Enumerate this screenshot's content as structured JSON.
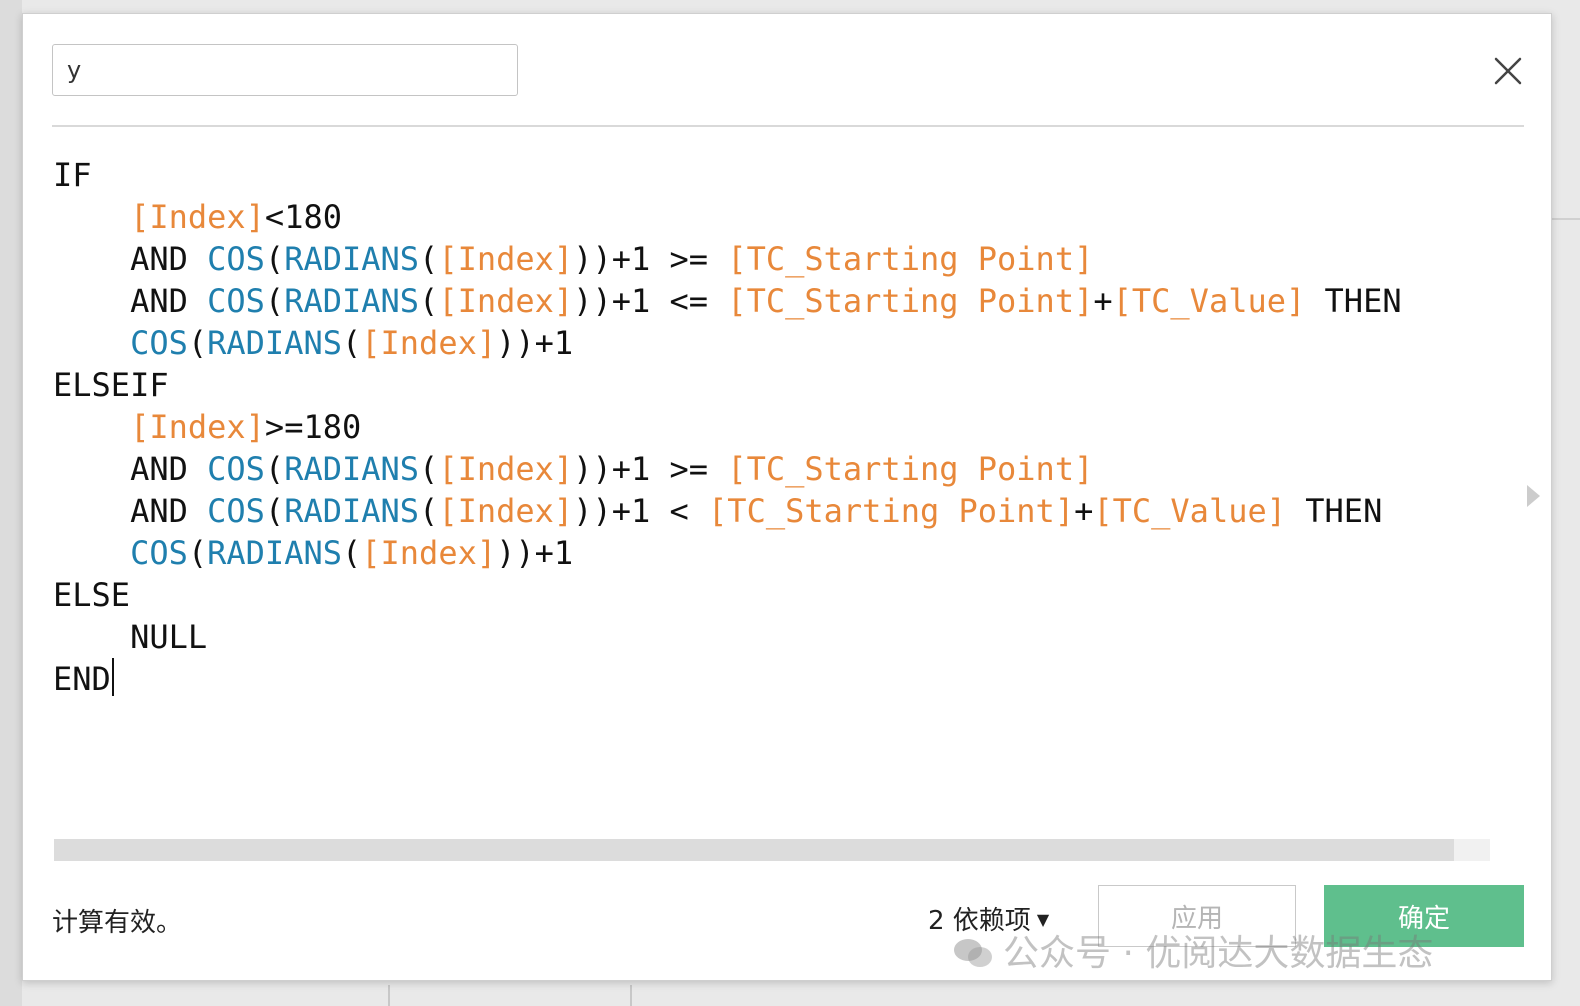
{
  "dialog": {
    "name_value": "y",
    "close_icon": "close-icon"
  },
  "editor": {
    "lines": [
      [
        {
          "t": "IF",
          "c": "kw"
        }
      ],
      [
        {
          "t": "    "
        },
        {
          "t": "[Index]",
          "c": "fld"
        },
        {
          "t": "<180",
          "c": "op"
        }
      ],
      [
        {
          "t": "    AND ",
          "c": "kw"
        },
        {
          "t": "COS",
          "c": "fn"
        },
        {
          "t": "(",
          "c": "op"
        },
        {
          "t": "RADIANS",
          "c": "fn"
        },
        {
          "t": "(",
          "c": "op"
        },
        {
          "t": "[Index]",
          "c": "fld"
        },
        {
          "t": "))+1 >= ",
          "c": "op"
        },
        {
          "t": "[TC_Starting Point]",
          "c": "fld"
        }
      ],
      [
        {
          "t": "    AND ",
          "c": "kw"
        },
        {
          "t": "COS",
          "c": "fn"
        },
        {
          "t": "(",
          "c": "op"
        },
        {
          "t": "RADIANS",
          "c": "fn"
        },
        {
          "t": "(",
          "c": "op"
        },
        {
          "t": "[Index]",
          "c": "fld"
        },
        {
          "t": "))+1 <= ",
          "c": "op"
        },
        {
          "t": "[TC_Starting Point]",
          "c": "fld"
        },
        {
          "t": "+",
          "c": "op"
        },
        {
          "t": "[TC_Value]",
          "c": "fld"
        },
        {
          "t": " THEN",
          "c": "kw"
        }
      ],
      [
        {
          "t": "    "
        },
        {
          "t": "COS",
          "c": "fn"
        },
        {
          "t": "(",
          "c": "op"
        },
        {
          "t": "RADIANS",
          "c": "fn"
        },
        {
          "t": "(",
          "c": "op"
        },
        {
          "t": "[Index]",
          "c": "fld"
        },
        {
          "t": "))+1",
          "c": "op"
        }
      ],
      [
        {
          "t": "ELSEIF",
          "c": "kw"
        }
      ],
      [
        {
          "t": "    "
        },
        {
          "t": "[Index]",
          "c": "fld"
        },
        {
          "t": ">=180",
          "c": "op"
        }
      ],
      [
        {
          "t": "    AND ",
          "c": "kw"
        },
        {
          "t": "COS",
          "c": "fn"
        },
        {
          "t": "(",
          "c": "op"
        },
        {
          "t": "RADIANS",
          "c": "fn"
        },
        {
          "t": "(",
          "c": "op"
        },
        {
          "t": "[Index]",
          "c": "fld"
        },
        {
          "t": "))+1 >= ",
          "c": "op"
        },
        {
          "t": "[TC_Starting Point]",
          "c": "fld"
        }
      ],
      [
        {
          "t": "    AND ",
          "c": "kw"
        },
        {
          "t": "COS",
          "c": "fn"
        },
        {
          "t": "(",
          "c": "op"
        },
        {
          "t": "RADIANS",
          "c": "fn"
        },
        {
          "t": "(",
          "c": "op"
        },
        {
          "t": "[Index]",
          "c": "fld"
        },
        {
          "t": "))+1 < ",
          "c": "op"
        },
        {
          "t": "[TC_Starting Point]",
          "c": "fld"
        },
        {
          "t": "+",
          "c": "op"
        },
        {
          "t": "[TC_Value]",
          "c": "fld"
        },
        {
          "t": " THEN",
          "c": "kw"
        }
      ],
      [
        {
          "t": "    "
        },
        {
          "t": "COS",
          "c": "fn"
        },
        {
          "t": "(",
          "c": "op"
        },
        {
          "t": "RADIANS",
          "c": "fn"
        },
        {
          "t": "(",
          "c": "op"
        },
        {
          "t": "[Index]",
          "c": "fld"
        },
        {
          "t": "))+1",
          "c": "op"
        }
      ],
      [
        {
          "t": "ELSE",
          "c": "kw"
        }
      ],
      [
        {
          "t": "    NULL",
          "c": "kw"
        }
      ],
      [
        {
          "t": "END",
          "c": "kw"
        }
      ]
    ],
    "colors": {
      "keyword": "#111111",
      "function": "#1f7fae",
      "field": "#e8883a"
    }
  },
  "footer": {
    "status": "计算有效。",
    "dependencies": "2 依赖项",
    "apply_label": "应用",
    "ok_label": "确定",
    "ok_color": "#5fbf8d"
  },
  "watermark": "公众号 · 优阅达大数据生态",
  "icons": {
    "close": "close-icon",
    "dropdown": "caret-down-icon",
    "expand": "chevron-right-icon",
    "wechat": "wechat-icon"
  }
}
